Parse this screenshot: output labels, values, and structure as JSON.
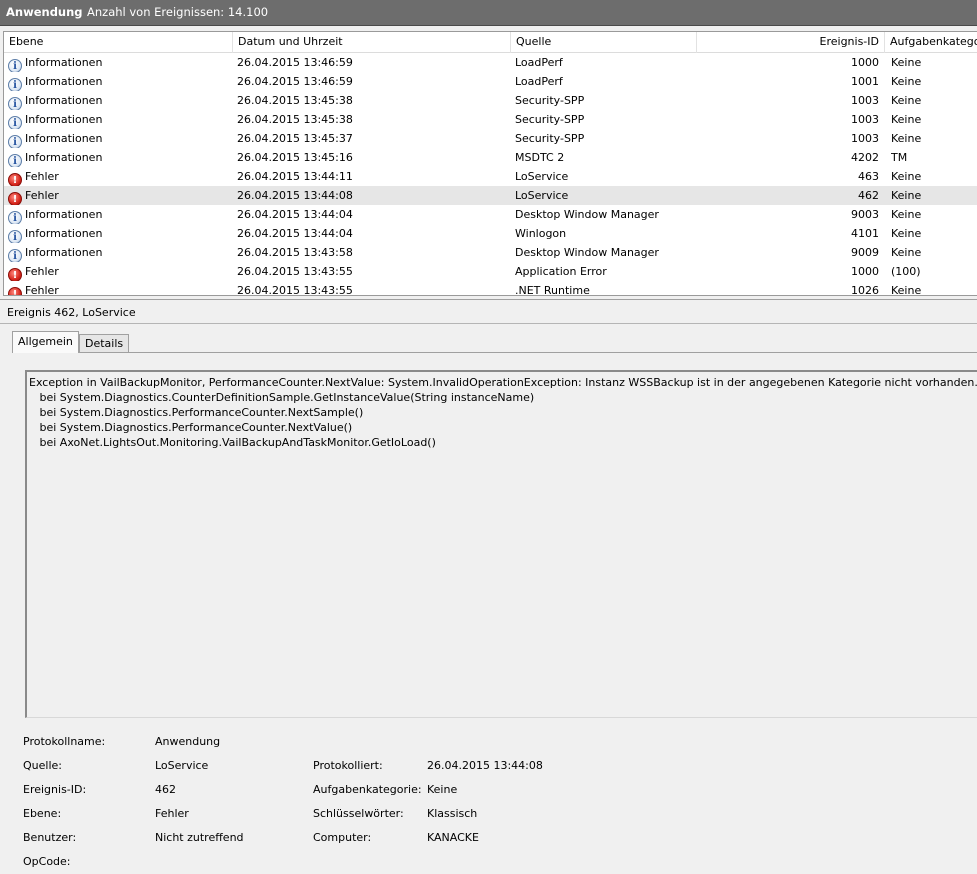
{
  "titlebar": {
    "log_name": "Anwendung",
    "event_count": "Anzahl von Ereignissen: 14.100"
  },
  "columns": {
    "level": "Ebene",
    "date": "Datum und Uhrzeit",
    "source": "Quelle",
    "event_id": "Ereignis-ID",
    "task_category": "Aufgabenkategorie"
  },
  "events": [
    {
      "level": "Informationen",
      "type": "info",
      "date": "26.04.2015 13:46:59",
      "source": "LoadPerf",
      "id": "1000",
      "task": "Keine"
    },
    {
      "level": "Informationen",
      "type": "info",
      "date": "26.04.2015 13:46:59",
      "source": "LoadPerf",
      "id": "1001",
      "task": "Keine"
    },
    {
      "level": "Informationen",
      "type": "info",
      "date": "26.04.2015 13:45:38",
      "source": "Security-SPP",
      "id": "1003",
      "task": "Keine"
    },
    {
      "level": "Informationen",
      "type": "info",
      "date": "26.04.2015 13:45:38",
      "source": "Security-SPP",
      "id": "1003",
      "task": "Keine"
    },
    {
      "level": "Informationen",
      "type": "info",
      "date": "26.04.2015 13:45:37",
      "source": "Security-SPP",
      "id": "1003",
      "task": "Keine"
    },
    {
      "level": "Informationen",
      "type": "info",
      "date": "26.04.2015 13:45:16",
      "source": "MSDTC 2",
      "id": "4202",
      "task": "TM"
    },
    {
      "level": "Fehler",
      "type": "error",
      "date": "26.04.2015 13:44:11",
      "source": "LoService",
      "id": "463",
      "task": "Keine"
    },
    {
      "level": "Fehler",
      "type": "error",
      "date": "26.04.2015 13:44:08",
      "source": "LoService",
      "id": "462",
      "task": "Keine",
      "selected": true
    },
    {
      "level": "Informationen",
      "type": "info",
      "date": "26.04.2015 13:44:04",
      "source": "Desktop Window Manager",
      "id": "9003",
      "task": "Keine"
    },
    {
      "level": "Informationen",
      "type": "info",
      "date": "26.04.2015 13:44:04",
      "source": "Winlogon",
      "id": "4101",
      "task": "Keine"
    },
    {
      "level": "Informationen",
      "type": "info",
      "date": "26.04.2015 13:43:58",
      "source": "Desktop Window Manager",
      "id": "9009",
      "task": "Keine"
    },
    {
      "level": "Fehler",
      "type": "error",
      "date": "26.04.2015 13:43:55",
      "source": "Application Error",
      "id": "1000",
      "task": "(100)"
    },
    {
      "level": "Fehler",
      "type": "error",
      "date": "26.04.2015 13:43:55",
      "source": ".NET Runtime",
      "id": "1026",
      "task": "Keine"
    }
  ],
  "detail": {
    "title": "Ereignis 462, LoService",
    "tabs": {
      "general": "Allgemein",
      "details": "Details"
    },
    "message": "Exception in VailBackupMonitor, PerformanceCounter.NextValue: System.InvalidOperationException: Instanz WSSBackup ist in der angegebenen Kategorie nicht vorhanden.\n   bei System.Diagnostics.CounterDefinitionSample.GetInstanceValue(String instanceName)\n   bei System.Diagnostics.PerformanceCounter.NextSample()\n   bei System.Diagnostics.PerformanceCounter.NextValue()\n   bei AxoNet.LightsOut.Monitoring.VailBackupAndTaskMonitor.GetIoLoad()",
    "fields": {
      "log_name_label": "Protokollname:",
      "log_name": "Anwendung",
      "source_label": "Quelle:",
      "source": "LoService",
      "logged_label": "Protokolliert:",
      "logged": "26.04.2015 13:44:08",
      "event_id_label": "Ereignis-ID:",
      "event_id": "462",
      "task_category_label": "Aufgabenkategorie:",
      "task_category": "Keine",
      "level_label": "Ebene:",
      "level": "Fehler",
      "keywords_label": "Schlüsselwörter:",
      "keywords": "Klassisch",
      "user_label": "Benutzer:",
      "user": "Nicht zutreffend",
      "computer_label": "Computer:",
      "computer": "KANACKE",
      "opcode_label": "OpCode:"
    }
  }
}
